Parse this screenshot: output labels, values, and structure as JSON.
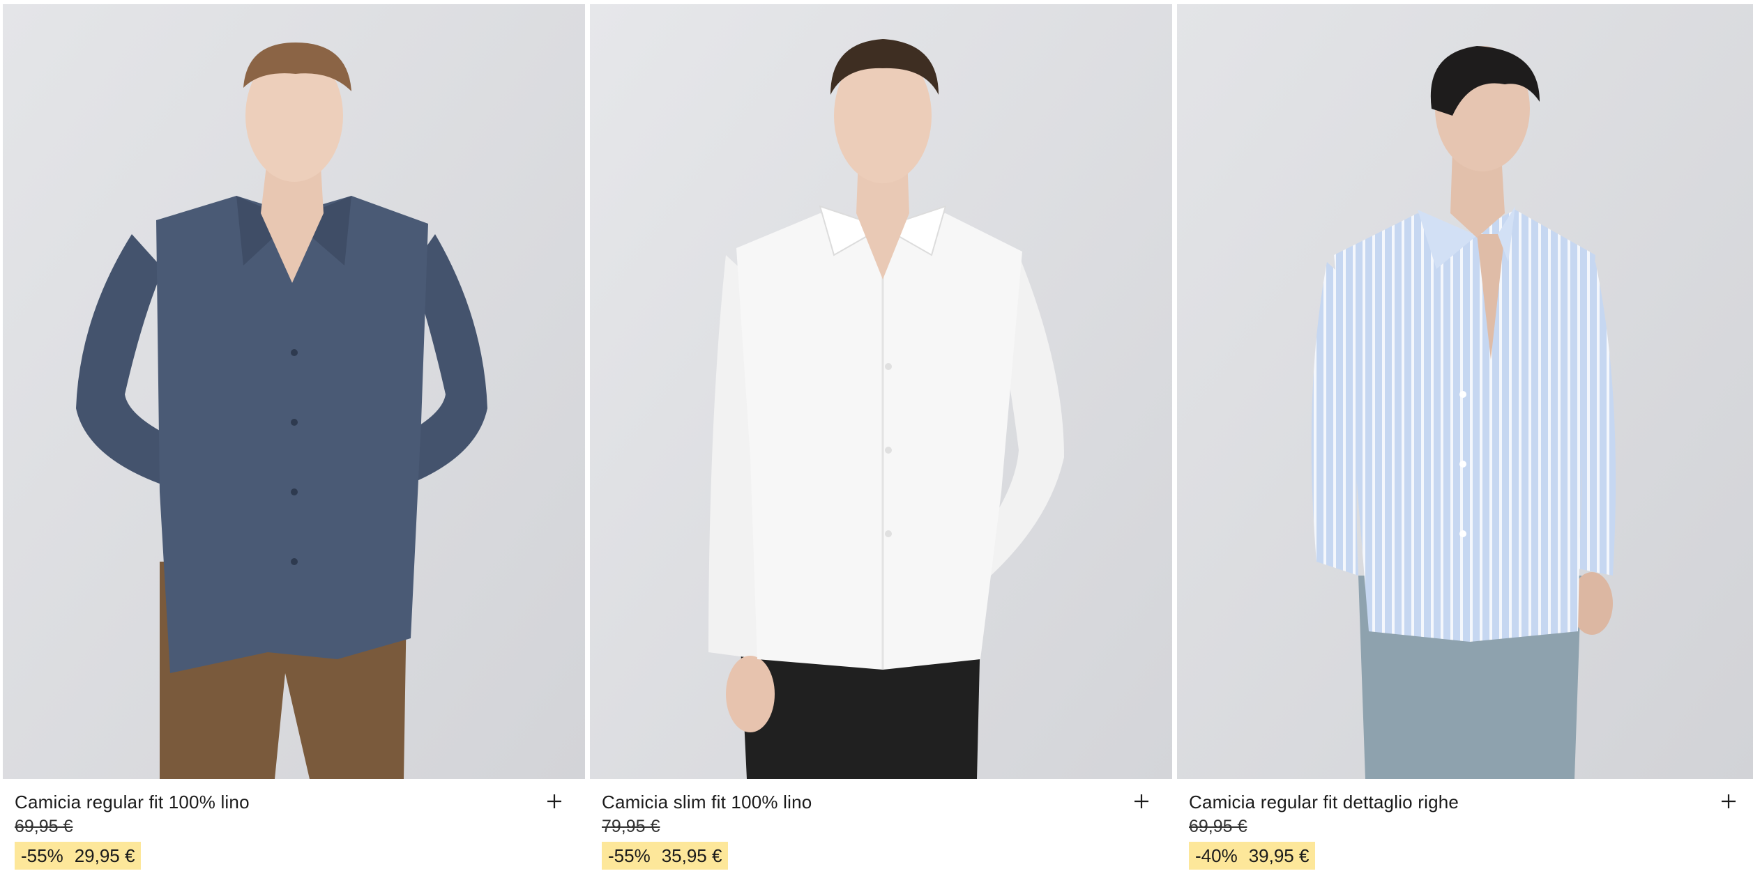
{
  "products": [
    {
      "name": "Camicia regular fit 100% lino",
      "old_price": "69,95 €",
      "discount": "-55%",
      "price": "29,95 €",
      "shirt_color": "#4a5a75",
      "trousers_color": "#7a5a3c",
      "add_icon": "plus-icon"
    },
    {
      "name": "Camicia slim fit 100% lino",
      "old_price": "79,95 €",
      "discount": "-55%",
      "price": "35,95 €",
      "shirt_color": "#f7f7f7",
      "trousers_color": "#202020",
      "add_icon": "plus-icon"
    },
    {
      "name": "Camicia regular fit dettaglio righe",
      "old_price": "69,95 €",
      "discount": "-40%",
      "price": "39,95 €",
      "shirt_color": "#bcd0ee",
      "trousers_color": "#8ea2ae",
      "add_icon": "plus-icon"
    }
  ],
  "colors": {
    "sale_highlight": "#fde79a",
    "photo_background": "#dcdde0"
  }
}
